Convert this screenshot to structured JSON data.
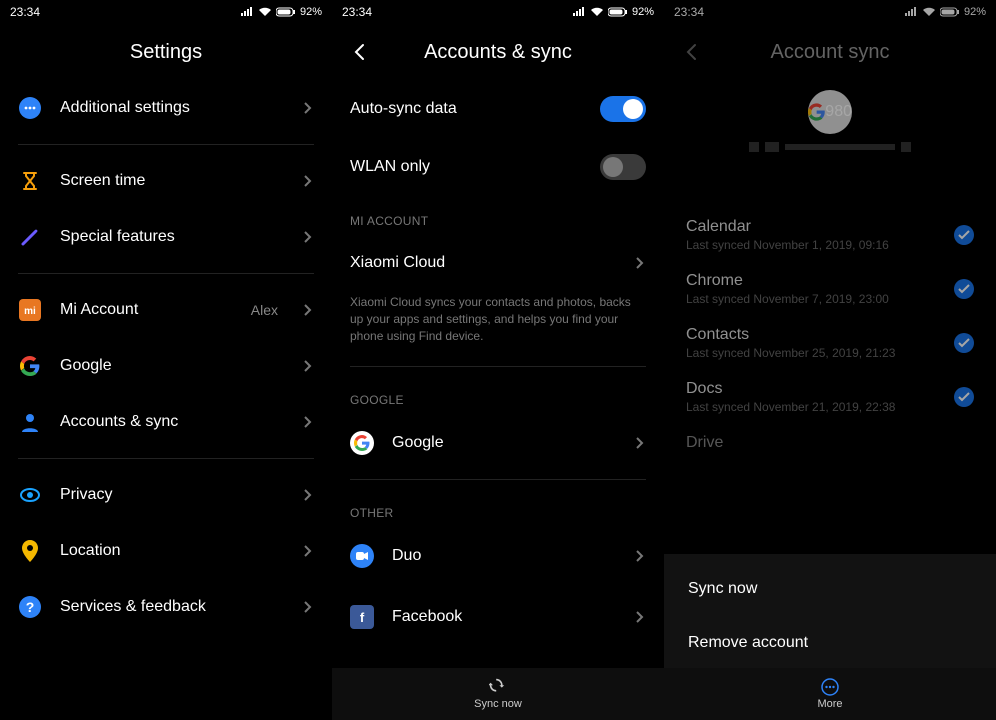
{
  "status": {
    "time": "23:34",
    "battery": "92"
  },
  "panel1": {
    "title": "Settings",
    "items": [
      {
        "label": "Additional settings"
      },
      {
        "label": "Screen time"
      },
      {
        "label": "Special features"
      },
      {
        "label": "Mi Account",
        "tail": "Alex"
      },
      {
        "label": "Google"
      },
      {
        "label": "Accounts & sync"
      },
      {
        "label": "Privacy"
      },
      {
        "label": "Location"
      },
      {
        "label": "Services & feedback"
      }
    ]
  },
  "panel2": {
    "title": "Accounts & sync",
    "auto_sync": "Auto-sync data",
    "wlan_only": "WLAN only",
    "section_mi": "MI ACCOUNT",
    "xiaomi_cloud": "Xiaomi Cloud",
    "xiaomi_desc": "Xiaomi Cloud syncs your contacts and photos, backs up your apps and settings, and helps you find your phone using Find device.",
    "section_google": "GOOGLE",
    "google": "Google",
    "section_other": "OTHER",
    "duo": "Duo",
    "facebook": "Facebook",
    "bottom_action": "Sync now"
  },
  "panel3": {
    "title": "Account sync",
    "items": [
      {
        "title": "Calendar",
        "sub": "Last synced November 1, 2019, 09:16"
      },
      {
        "title": "Chrome",
        "sub": "Last synced November 7, 2019, 23:00"
      },
      {
        "title": "Contacts",
        "sub": "Last synced November 25, 2019, 21:23"
      },
      {
        "title": "Docs",
        "sub": "Last synced November 21, 2019, 22:38"
      },
      {
        "title": "Drive",
        "sub": ""
      }
    ],
    "menu": {
      "sync_now": "Sync now",
      "remove": "Remove account"
    },
    "bottom_action": "More"
  }
}
